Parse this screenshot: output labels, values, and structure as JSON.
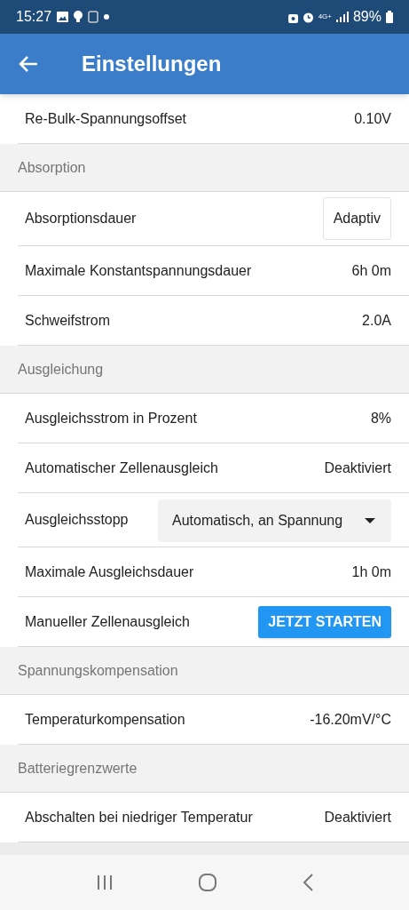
{
  "status_bar": {
    "time": "15:27",
    "network": "4G+",
    "battery": "89%"
  },
  "app_bar": {
    "title": "Einstellungen"
  },
  "list": [
    {
      "kind": "text",
      "label": "Re-Bulk-Spannungsoffset",
      "value": "0.10V"
    },
    {
      "kind": "header",
      "label": "Absorption"
    },
    {
      "kind": "box",
      "label": "Absorptionsdauer",
      "value": "Adaptiv"
    },
    {
      "kind": "text",
      "label": "Maximale Konstantspannungsdauer",
      "value": "6h 0m"
    },
    {
      "kind": "text",
      "label": "Schweifstrom",
      "value": "2.0A"
    },
    {
      "kind": "header",
      "label": "Ausgleichung"
    },
    {
      "kind": "text",
      "label": "Ausgleichsstrom in Prozent",
      "value": "8%"
    },
    {
      "kind": "text",
      "label": "Automatischer Zellenausgleich",
      "value": "Deaktiviert"
    },
    {
      "kind": "dropdown",
      "label": "Ausgleichsstopp",
      "value": "Automatisch, an Spannung"
    },
    {
      "kind": "text",
      "label": "Maximale Ausgleichsdauer",
      "value": "1h 0m"
    },
    {
      "kind": "button",
      "label": "Manueller Zellenausgleich",
      "value": "JETZT STARTEN"
    },
    {
      "kind": "header",
      "label": "Spannungskompensation"
    },
    {
      "kind": "text",
      "label": "Temperaturkompensation",
      "value": "-16.20mV/°C"
    },
    {
      "kind": "header",
      "label": "Batteriegrenzwerte"
    },
    {
      "kind": "text",
      "label": "Abschalten bei niedriger Temperatur",
      "value": "Deaktiviert"
    }
  ]
}
